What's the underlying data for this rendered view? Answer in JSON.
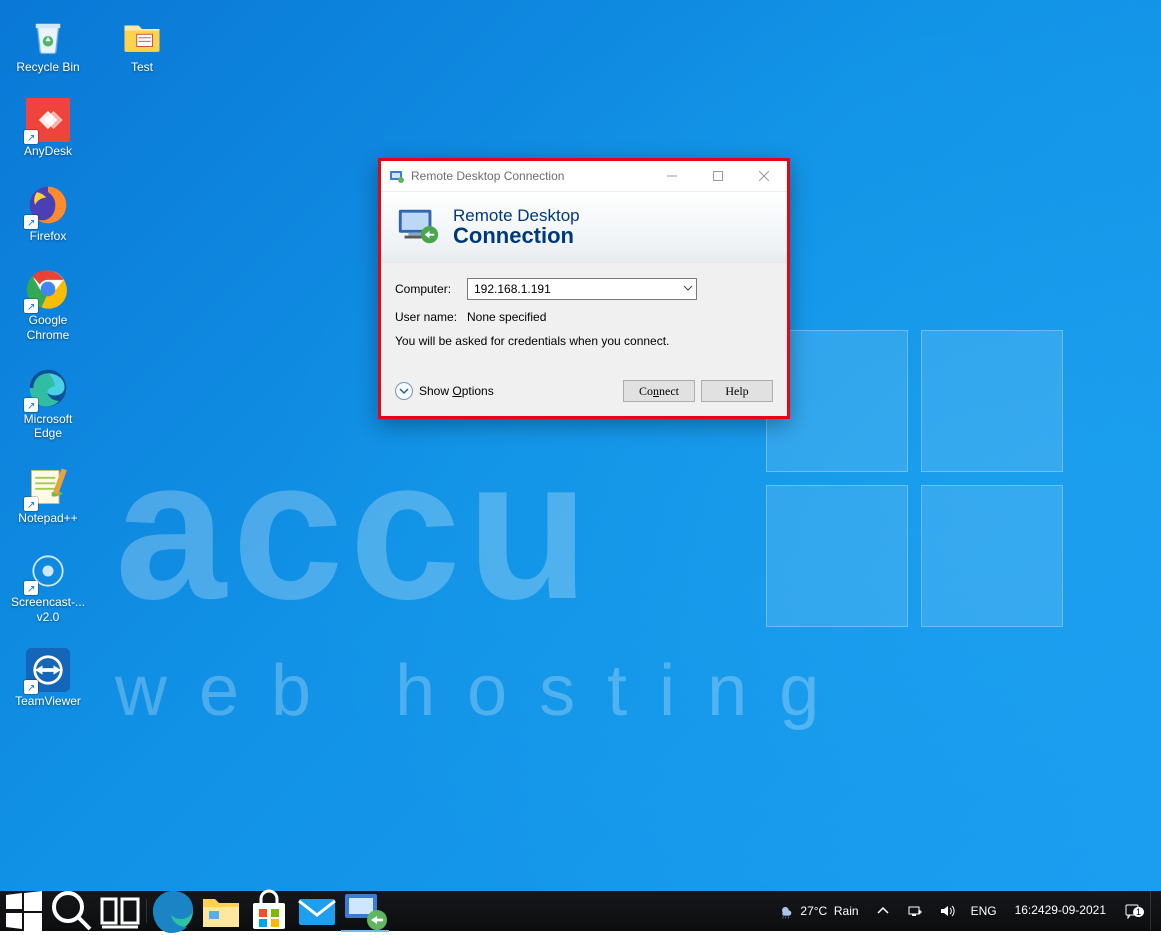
{
  "desktop_icons": [
    {
      "id": "recycle-bin",
      "label": "Recycle Bin",
      "shortcut": false
    },
    {
      "id": "test-folder",
      "label": "Test",
      "shortcut": false
    },
    {
      "id": "anydesk",
      "label": "AnyDesk",
      "shortcut": true
    },
    {
      "id": "firefox",
      "label": "Firefox",
      "shortcut": true
    },
    {
      "id": "chrome",
      "label": "Google\nChrome",
      "shortcut": true
    },
    {
      "id": "edge",
      "label": "Microsoft\nEdge",
      "shortcut": true
    },
    {
      "id": "notepadpp",
      "label": "Notepad++",
      "shortcut": true
    },
    {
      "id": "screencast",
      "label": "Screencast-...\nv2.0",
      "shortcut": true
    },
    {
      "id": "teamviewer",
      "label": "TeamViewer",
      "shortcut": true
    }
  ],
  "rdc": {
    "window_title": "Remote Desktop Connection",
    "banner_line1": "Remote Desktop",
    "banner_line2": "Connection",
    "computer_label": "Computer:",
    "computer_value": "192.168.1.191",
    "username_label": "User name:",
    "username_value": "None specified",
    "hint": "You will be asked for credentials when you connect.",
    "show_options": "Show Options",
    "connect": "Connect",
    "help": "Help"
  },
  "taskbar": {
    "pinned": [
      {
        "id": "start",
        "name": "start-button"
      },
      {
        "id": "search",
        "name": "search-button"
      },
      {
        "id": "taskview",
        "name": "task-view-button"
      },
      {
        "id": "edge",
        "name": "taskbar-edge"
      },
      {
        "id": "explorer",
        "name": "taskbar-file-explorer"
      },
      {
        "id": "store",
        "name": "taskbar-store"
      },
      {
        "id": "mail",
        "name": "taskbar-mail"
      },
      {
        "id": "rdc",
        "name": "taskbar-rdc"
      }
    ],
    "weather": {
      "temp": "27°C",
      "cond": "Rain"
    },
    "tray": {
      "lang": "ENG"
    },
    "clock": {
      "time": "16:24",
      "date": "29-09-2021"
    }
  },
  "watermark": {
    "line1_letters": [
      "a",
      "c",
      "c",
      "u"
    ],
    "line2": "web hosting"
  }
}
